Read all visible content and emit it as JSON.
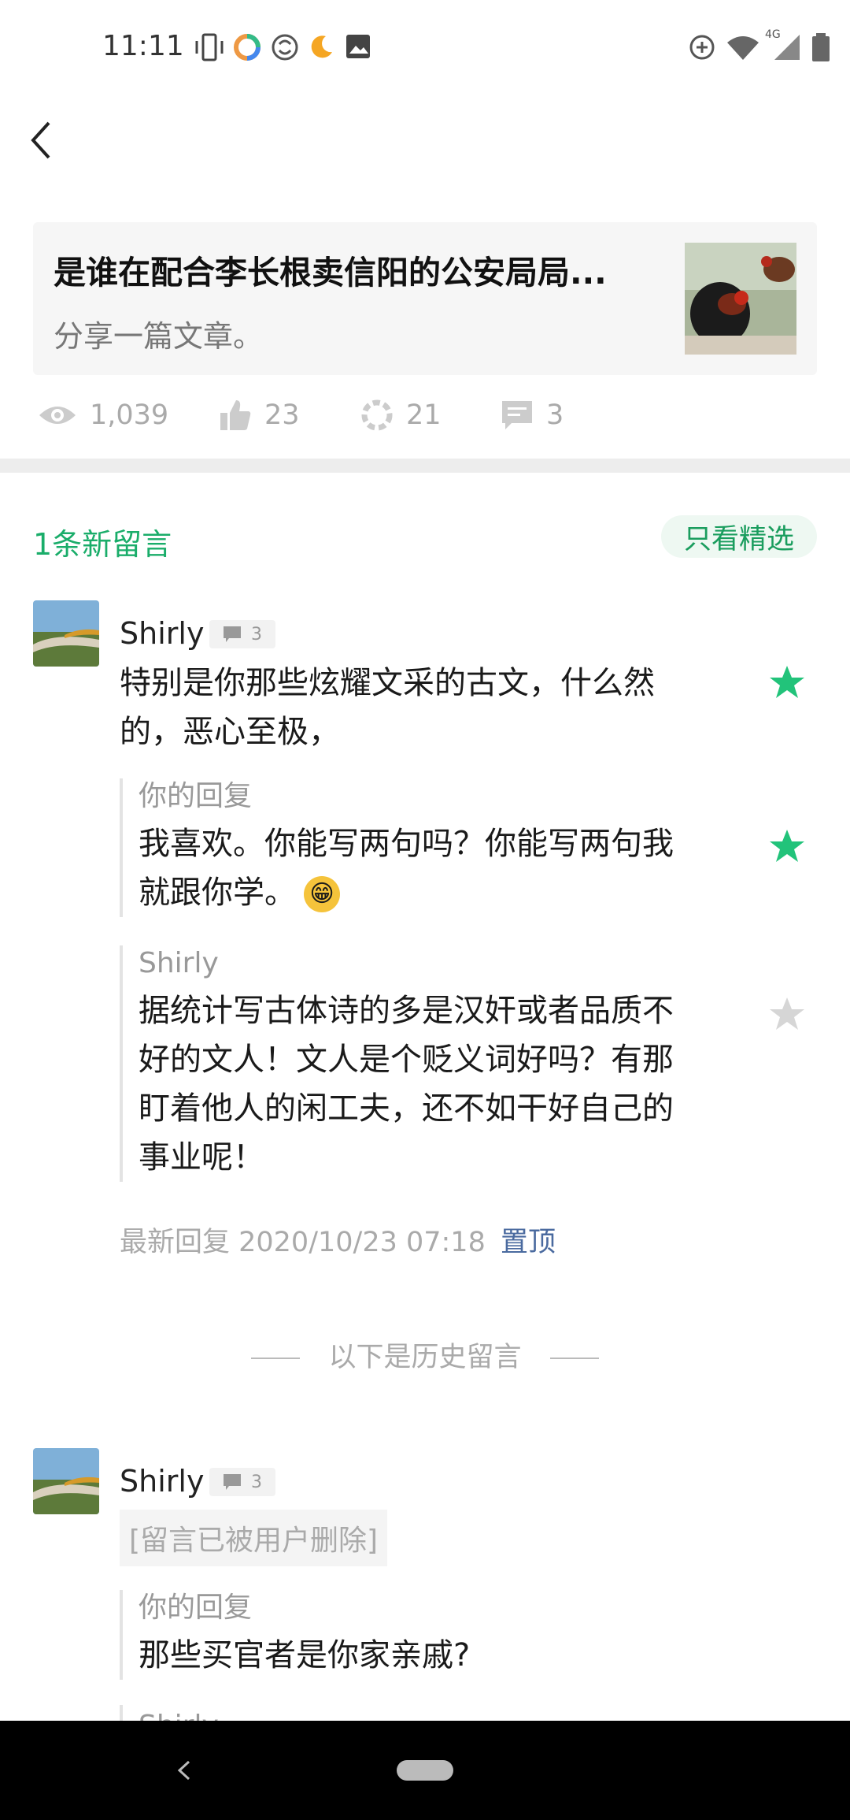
{
  "status_bar": {
    "time": "11:11",
    "network": "4G"
  },
  "article": {
    "title": "是谁在配合李长根卖信阳的公安局局...",
    "subtitle": "分享一篇文章。"
  },
  "stats": {
    "views": "1,039",
    "likes": "23",
    "shares": "21",
    "comments": "3"
  },
  "section": {
    "new_comments": "1条新留言",
    "featured_filter": "只看精选"
  },
  "comments": [
    {
      "user": "Shirly",
      "reply_count": "3",
      "text_line1": "特别是你那些炫耀文采的古文，什么然",
      "text_line2": "的，恶心至极，",
      "replies": [
        {
          "author": "你的回复",
          "line1": "我喜欢。你能写两句吗？你能写两句我",
          "line2": "就跟你学。",
          "emoji": "😁"
        },
        {
          "author": "Shirly",
          "line1": "据统计写古体诗的多是汉奸或者品质不",
          "line2": "好的文人！文人是个贬义词好吗？有那",
          "line3": "盯着他人的闲工夫，还不如干好自己的",
          "line4": "事业呢！"
        }
      ],
      "latest_reply": "最新回复 2020/10/23 07:18",
      "pin_label": "置顶"
    }
  ],
  "history_label": "以下是历史留言",
  "history_comments": [
    {
      "user": "Shirly",
      "reply_count": "3",
      "deleted_text": "[留言已被用户删除]",
      "reply_author": "你的回复",
      "reply_text": "那些买官者是你家亲戚?",
      "next_author": "Shirly"
    }
  ],
  "colors": {
    "accent_green": "#1aad6a",
    "star_green": "#22c37a",
    "star_gray": "#d6d6d6",
    "link_blue": "#4a6a9f"
  }
}
